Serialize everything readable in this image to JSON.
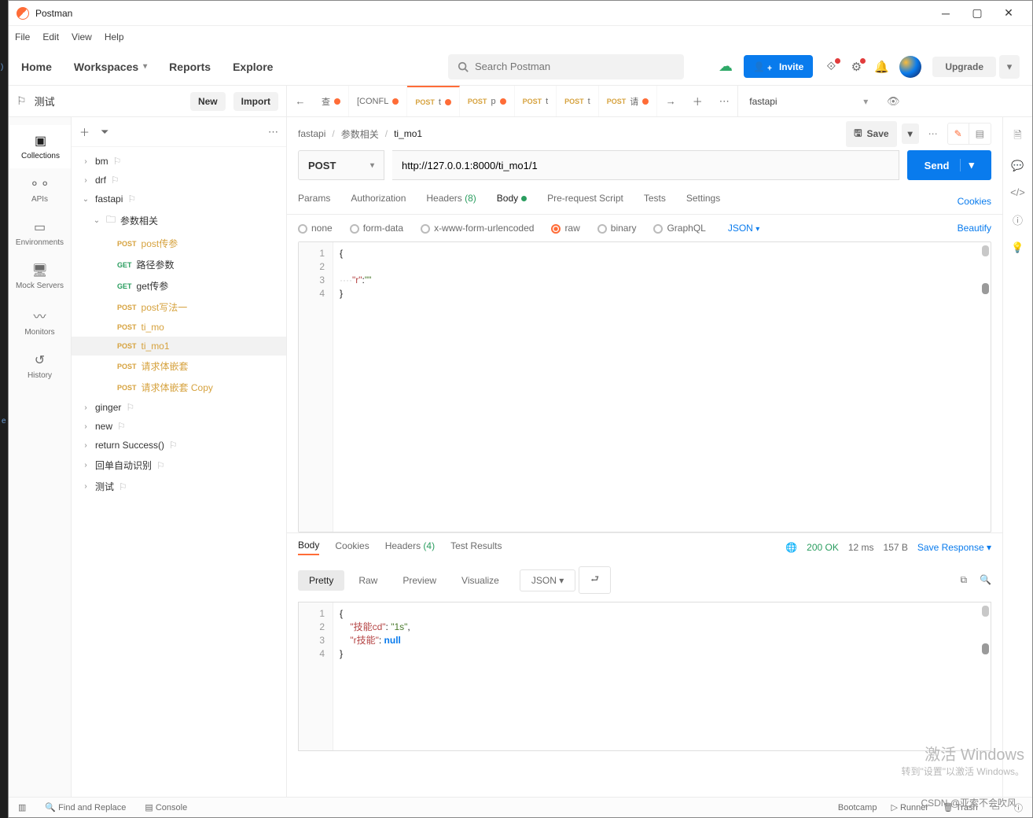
{
  "window": {
    "title": "Postman"
  },
  "menu": {
    "file": "File",
    "edit": "Edit",
    "view": "View",
    "help": "Help"
  },
  "topnav": {
    "home": "Home",
    "workspaces": "Workspaces",
    "reports": "Reports",
    "explore": "Explore",
    "search_placeholder": "Search Postman",
    "invite": "Invite",
    "upgrade": "Upgrade"
  },
  "workspace": {
    "name": "测试",
    "new": "New",
    "import": "Import"
  },
  "tabs": [
    {
      "method": "",
      "label": "查",
      "dot": true
    },
    {
      "method": "",
      "label": "[CONFL",
      "dot": true
    },
    {
      "method": "POST",
      "label": "t",
      "dot": true,
      "active": true
    },
    {
      "method": "POST",
      "label": "p",
      "dot": true
    },
    {
      "method": "POST",
      "label": "t",
      "dot": false
    },
    {
      "method": "POST",
      "label": "t",
      "dot": false
    },
    {
      "method": "POST",
      "label": "请",
      "dot": true
    }
  ],
  "env": {
    "name": "fastapi"
  },
  "rail": [
    {
      "icon": "▣",
      "label": "Collections",
      "active": true
    },
    {
      "icon": "⚬⚬",
      "label": "APIs"
    },
    {
      "icon": "▭",
      "label": "Environments"
    },
    {
      "icon": "🖥",
      "label": "Mock Servers"
    },
    {
      "icon": "〰",
      "label": "Monitors"
    },
    {
      "icon": "↺",
      "label": "History"
    }
  ],
  "tree": {
    "bm": "bm",
    "drf": "drf",
    "fastapi": "fastapi",
    "folder": "参数相关",
    "items": [
      {
        "m": "POST",
        "n": "post传参"
      },
      {
        "m": "GET",
        "n": "路径参数"
      },
      {
        "m": "GET",
        "n": "get传参"
      },
      {
        "m": "POST",
        "n": "post写法一"
      },
      {
        "m": "POST",
        "n": "ti_mo"
      },
      {
        "m": "POST",
        "n": "ti_mo1",
        "sel": true
      },
      {
        "m": "POST",
        "n": "请求体嵌套"
      },
      {
        "m": "POST",
        "n": "请求体嵌套 Copy"
      }
    ],
    "ginger": "ginger",
    "new": "new",
    "return": "return Success()",
    "auto": "回单自动识别",
    "test": "测试"
  },
  "breadcrumb": {
    "a": "fastapi",
    "b": "参数相关",
    "c": "ti_mo1",
    "save": "Save"
  },
  "request": {
    "method": "POST",
    "url": "http://127.0.0.1:8000/ti_mo1/1",
    "send": "Send"
  },
  "reqtabs": {
    "params": "Params",
    "auth": "Authorization",
    "headers": "Headers",
    "hcount": "(8)",
    "body": "Body",
    "prereq": "Pre-request Script",
    "tests": "Tests",
    "settings": "Settings",
    "cookies": "Cookies"
  },
  "bodyopts": {
    "none": "none",
    "form": "form-data",
    "xwww": "x-www-form-urlencoded",
    "raw": "raw",
    "binary": "binary",
    "graphql": "GraphQL",
    "json": "JSON",
    "beautify": "Beautify"
  },
  "bodycode": {
    "l1": "{",
    "l2": "",
    "l3_key": "\"r\"",
    "l3_sep": ":",
    "l3_val": "\"\"",
    "l4": "}",
    "indent": "····"
  },
  "resptabs": {
    "body": "Body",
    "cookies": "Cookies",
    "headers": "Headers",
    "hcount": "(4)",
    "test": "Test Results"
  },
  "respmeta": {
    "status": "200 OK",
    "time": "12 ms",
    "size": "157 B",
    "save": "Save Response"
  },
  "respview": {
    "pretty": "Pretty",
    "raw": "Raw",
    "preview": "Preview",
    "visualize": "Visualize",
    "json": "JSON"
  },
  "respcode": {
    "l1": "{",
    "l2_k": "\"技能cd\"",
    "l2_v": "\"1s\"",
    "l3_k": "\"r技能\"",
    "l3_v": "null",
    "l4": "}"
  },
  "status": {
    "find": "Find and Replace",
    "console": "Console",
    "boot": "Bootcamp",
    "runner": "Runner",
    "trash": "Trash"
  },
  "watermark": {
    "l1": "激活 Windows",
    "l2": "转到\"设置\"以激活 Windows。"
  },
  "csdn": "CSDN @亚索不会吹风"
}
